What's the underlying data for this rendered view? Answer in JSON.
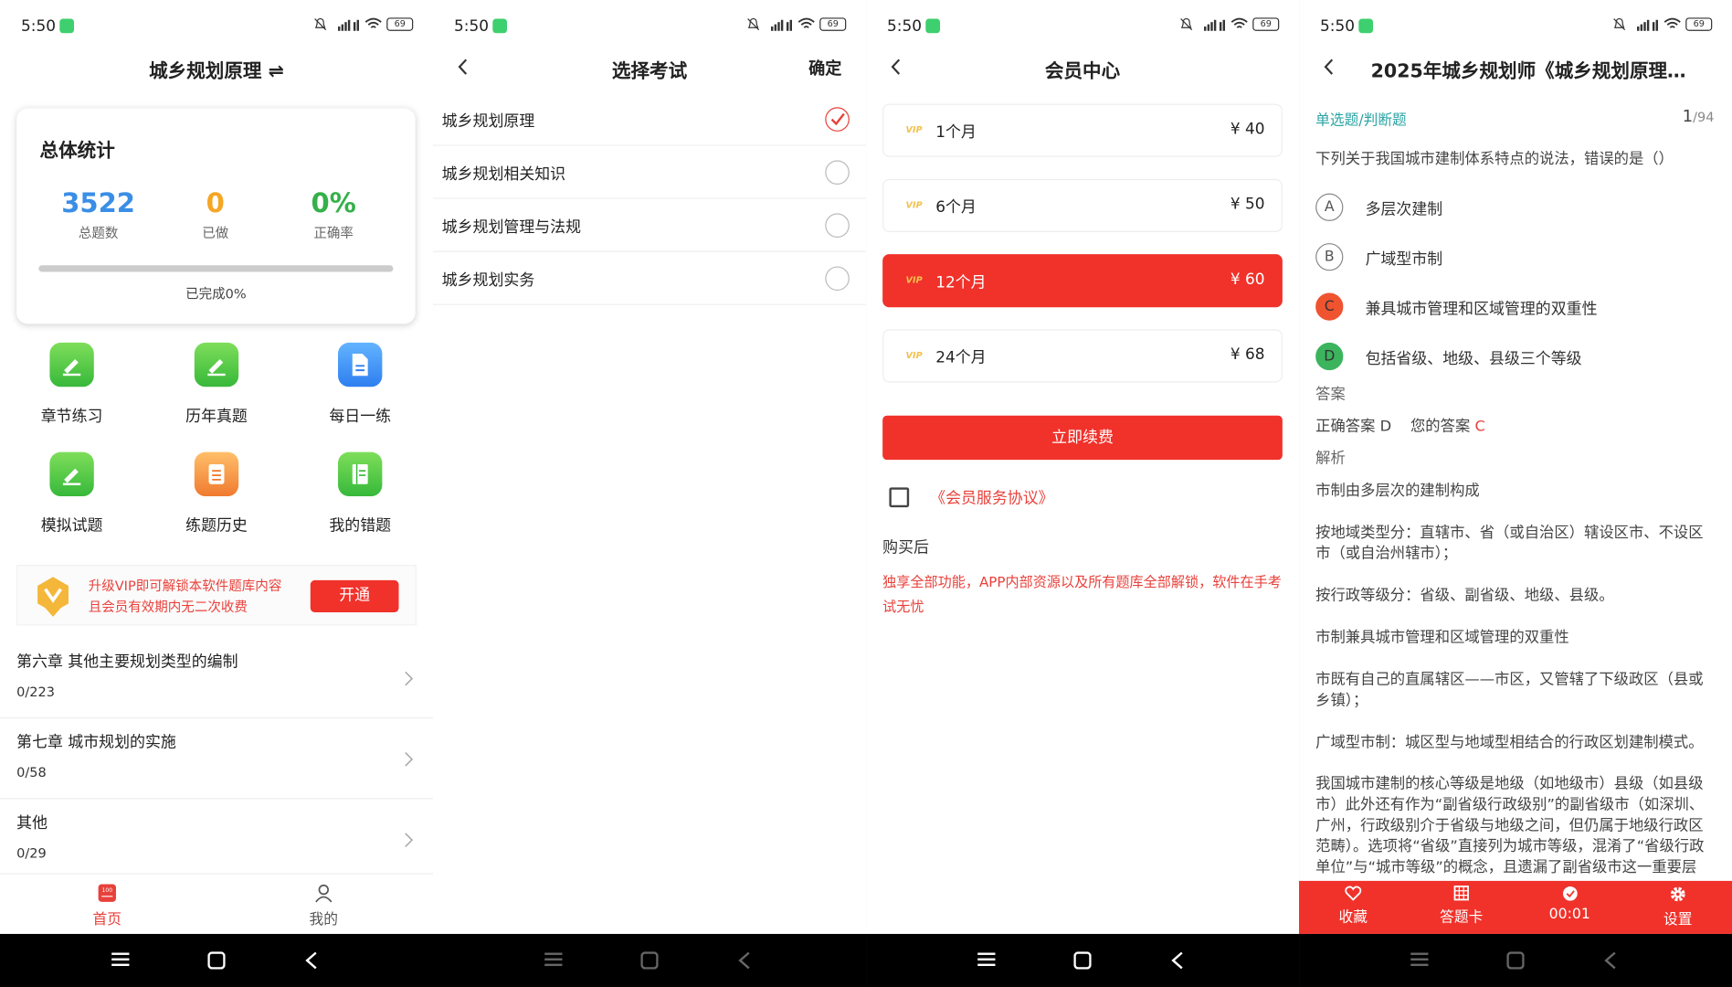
{
  "status": {
    "time": "5:50",
    "battery": "69",
    "network": "5G"
  },
  "p1": {
    "title": "城乡规划原理 ⇌",
    "card_title": "总体统计",
    "stats": [
      {
        "value": "3522",
        "label": "总题数",
        "color": "#3a8ee6"
      },
      {
        "value": "0",
        "label": "已做",
        "color": "#f5a623"
      },
      {
        "value": "0%",
        "label": "正确率",
        "color": "#35b04a"
      }
    ],
    "progress_text": "已完成0%",
    "progress": 0,
    "grid": [
      {
        "label": "章节练习",
        "icon": "pencil-icon"
      },
      {
        "label": "历年真题",
        "icon": "pencil-icon"
      },
      {
        "label": "每日一练",
        "icon": "document-icon"
      },
      {
        "label": "模拟试题",
        "icon": "pencil-icon"
      },
      {
        "label": "练题历史",
        "icon": "history-icon"
      },
      {
        "label": "我的错题",
        "icon": "notebook-icon"
      }
    ],
    "vip_text1": "升级VIP即可解锁本软件题库内容",
    "vip_text2": "且会员有效期内无二次收费",
    "vip_button": "开通",
    "chapters": [
      {
        "title": "第六章 其他主要规划类型的编制",
        "count": "0/223"
      },
      {
        "title": "第七章 城市规划的实施",
        "count": "0/58"
      },
      {
        "title": "其他",
        "count": "0/29"
      }
    ],
    "tabs": [
      "首页",
      "我的"
    ]
  },
  "p2": {
    "title": "选择考试",
    "confirm": "确定",
    "options": [
      {
        "label": "城乡规划原理",
        "selected": true
      },
      {
        "label": "城乡规划相关知识",
        "selected": false
      },
      {
        "label": "城乡规划管理与法规",
        "selected": false
      },
      {
        "label": "城乡规划实务",
        "selected": false
      }
    ]
  },
  "p3": {
    "title": "会员中心",
    "plans": [
      {
        "vip": "VIP",
        "name": "1个月",
        "price": "¥ 40"
      },
      {
        "vip": "VIP",
        "name": "6个月",
        "price": "¥ 50"
      },
      {
        "vip": "VIP",
        "name": "12个月",
        "price": "¥ 60"
      },
      {
        "vip": "VIP",
        "name": "24个月",
        "price": "¥ 68"
      }
    ],
    "selected_plan": 2,
    "renew": "立即续费",
    "agreement": "《会员服务协议》",
    "after_label": "购买后",
    "after_text1": "独享全部功能，APP内部资源以及所有题库全部解锁，软件在手考",
    "after_text2": "试无忧"
  },
  "p4": {
    "title": "2025年城乡规划师《城乡规划原理…",
    "type": "单选题/判断题",
    "page": "1",
    "total": "/94",
    "question": "下列关于我国城市建制体系特点的说法，错误的是（）",
    "choices": [
      {
        "key": "A",
        "text": "多层次建制"
      },
      {
        "key": "B",
        "text": "广域型市制"
      },
      {
        "key": "C",
        "text": "兼具城市管理和区域管理的双重性"
      },
      {
        "key": "D",
        "text": "包括省级、地级、县级三个等级"
      }
    ],
    "answer_label": "答案",
    "correct_label": "正确答案 D",
    "your_label": "您的答案",
    "your_answer": "C",
    "analysis_label": "解析",
    "lines": [
      "市制由多层次的建制构成",
      "按地域类型分：直辖市、省（或自治区）辖设区市、不设区",
      "市（或自治州辖市）；",
      "按行政等级分：省级、副省级、地级、县级。",
      "市制兼具城市管理和区域管理的双重性",
      "市既有自己的直属辖区——市区，又管辖了下级政区（县或",
      "乡镇）；",
      "广域型市制：城区型与地域型相结合的行政区划建制模式。",
      "我国城市建制的核心等级是地级（如地级市）县级（如县级",
      "市）此外还有作为“副省级行政级别”的副省级市（如深圳、",
      "广州，行政级别介于省级与地级之间，但仍属于地级行政区",
      "范畴）。选项将“省级”直接列为城市等级，混淆了“省级行政",
      "单位”与“城市等级”的概念，且遗漏了副省级市这一重要层"
    ],
    "bottom": [
      "收藏",
      "答题卡",
      "00:01",
      "设置"
    ]
  }
}
